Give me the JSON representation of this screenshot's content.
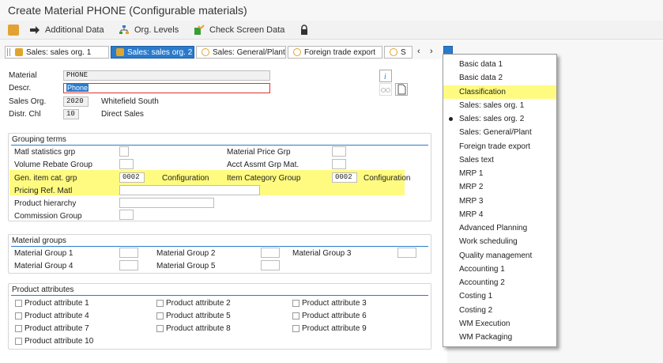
{
  "title": "Create Material PHONE (Configurable materials)",
  "toolbar": {
    "additional_data": "Additional Data",
    "org_levels": "Org. Levels",
    "check_screen_data": "Check Screen Data"
  },
  "tabs": [
    "Sales: sales org. 1",
    "Sales: sales org. 2",
    "Sales: General/Plant",
    "Foreign trade export",
    "S"
  ],
  "header": {
    "material_label": "Material",
    "material_value": "PHONE",
    "descr_label": "Descr.",
    "descr_value": "Phone",
    "sales_org_label": "Sales Org.",
    "sales_org_value": "2020",
    "sales_org_text": "Whitefield South",
    "distr_chl_label": "Distr. Chl",
    "distr_chl_value": "10",
    "distr_chl_text": "Direct Sales"
  },
  "grouping": {
    "title": "Grouping terms",
    "matl_statistics_grp": "Matl statistics grp",
    "volume_rebate_group": "Volume Rebate Group",
    "gen_item_cat_grp": "Gen. item cat. grp",
    "gen_item_cat_value": "0002",
    "gen_item_cat_text": "Configuration",
    "pricing_ref_matl": "Pricing Ref. Matl",
    "product_hierarchy": "Product hierarchy",
    "commission_group": "Commission Group",
    "material_price_grp": "Material Price Grp",
    "acct_assmt_grp_mat": "Acct Assmt Grp Mat.",
    "item_category_group": "Item Category Group",
    "item_category_value": "0002",
    "item_category_text": "Configuration"
  },
  "material_groups": {
    "title": "Material groups",
    "g1": "Material Group 1",
    "g2": "Material Group 2",
    "g3": "Material Group 3",
    "g4": "Material Group 4",
    "g5": "Material Group 5"
  },
  "product_attributes": {
    "title": "Product attributes",
    "items": [
      "Product attribute 1",
      "Product attribute 2",
      "Product attribute 3",
      "Product attribute 4",
      "Product attribute 5",
      "Product attribute 6",
      "Product attribute 7",
      "Product attribute 8",
      "Product attribute 9",
      "Product attribute 10"
    ]
  },
  "menu": {
    "items": [
      "Basic data 1",
      "Basic data 2",
      "Classification",
      "Sales: sales org. 1",
      "Sales: sales org. 2",
      "Sales: General/Plant",
      "Foreign trade export",
      "Sales text",
      "MRP 1",
      "MRP 2",
      "MRP 3",
      "MRP 4",
      "Advanced Planning",
      "Work scheduling",
      "Quality management",
      "Accounting 1",
      "Accounting 2",
      "Costing 1",
      "Costing 2",
      "WM Execution",
      "WM Packaging"
    ],
    "highlighted": "Classification",
    "current": "Sales: sales org. 2"
  },
  "colors": {
    "highlight": "#fffb80",
    "accent": "#2b7bcc"
  }
}
